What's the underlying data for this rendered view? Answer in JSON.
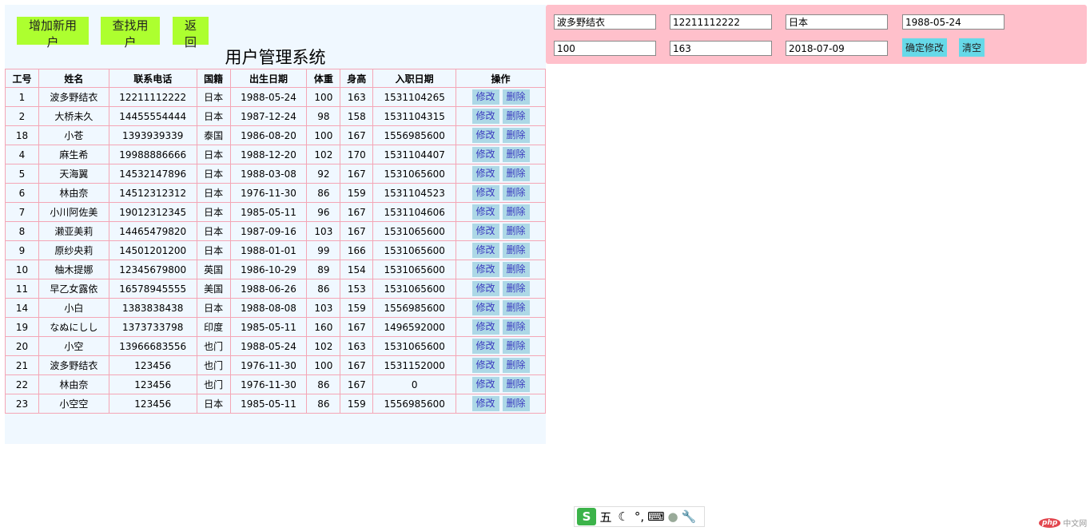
{
  "toolbar": {
    "add_label": "增加新用户",
    "find_label": "查找用户",
    "back_label": "返回"
  },
  "page_title": "用户管理系统",
  "table": {
    "headers": [
      "工号",
      "姓名",
      "联系电话",
      "国籍",
      "出生日期",
      "体重",
      "身高",
      "入职日期",
      "操作"
    ],
    "edit_label": "修改",
    "delete_label": "删除",
    "rows": [
      [
        "1",
        "波多野结衣",
        "12211112222",
        "日本",
        "1988-05-24",
        "100",
        "163",
        "1531104265"
      ],
      [
        "2",
        "大桥未久",
        "14455554444",
        "日本",
        "1987-12-24",
        "98",
        "158",
        "1531104315"
      ],
      [
        "18",
        "小苍",
        "1393939339",
        "泰国",
        "1986-08-20",
        "100",
        "167",
        "1556985600"
      ],
      [
        "4",
        "麻生希",
        "19988886666",
        "日本",
        "1988-12-20",
        "102",
        "170",
        "1531104407"
      ],
      [
        "5",
        "天海翼",
        "14532147896",
        "日本",
        "1988-03-08",
        "92",
        "167",
        "1531065600"
      ],
      [
        "6",
        "林由奈",
        "14512312312",
        "日本",
        "1976-11-30",
        "86",
        "159",
        "1531104523"
      ],
      [
        "7",
        "小川阿佐美",
        "19012312345",
        "日本",
        "1985-05-11",
        "96",
        "167",
        "1531104606"
      ],
      [
        "8",
        "濑亚美莉",
        "14465479820",
        "日本",
        "1987-09-16",
        "103",
        "167",
        "1531065600"
      ],
      [
        "9",
        "原纱央莉",
        "14501201200",
        "日本",
        "1988-01-01",
        "99",
        "166",
        "1531065600"
      ],
      [
        "10",
        "柚木提娜",
        "12345679800",
        "英国",
        "1986-10-29",
        "89",
        "154",
        "1531065600"
      ],
      [
        "11",
        "早乙女露依",
        "16578945555",
        "美国",
        "1988-06-26",
        "86",
        "153",
        "1531065600"
      ],
      [
        "14",
        "小白",
        "1383838438",
        "日本",
        "1988-08-08",
        "103",
        "159",
        "1556985600"
      ],
      [
        "19",
        "なぬにしし",
        "1373733798",
        "印度",
        "1985-05-11",
        "160",
        "167",
        "1496592000"
      ],
      [
        "20",
        "小空",
        "13966683556",
        "也门",
        "1988-05-24",
        "102",
        "163",
        "1531065600"
      ],
      [
        "21",
        "波多野结衣",
        "123456",
        "也门",
        "1976-11-30",
        "100",
        "167",
        "1531152000"
      ],
      [
        "22",
        "林由奈",
        "123456",
        "也门",
        "1976-11-30",
        "86",
        "167",
        "0"
      ],
      [
        "23",
        "小空空",
        "123456",
        "日本",
        "1985-05-11",
        "86",
        "159",
        "1556985600"
      ]
    ]
  },
  "edit_form": {
    "name": "波多野结衣",
    "phone": "12211112222",
    "country": "日本",
    "birthday": "1988-05-24",
    "weight": "100",
    "height": "163",
    "hire_date": "2018-07-09",
    "confirm_label": "确定修改",
    "clear_label": "清空"
  },
  "ime": {
    "logo": "S",
    "mode": "五",
    "icons": [
      "moon-icon",
      "punctuation-icon",
      "keyboard-icon",
      "user-icon",
      "wrench-icon"
    ]
  },
  "watermark": {
    "logo": "php",
    "text": "中文网"
  }
}
